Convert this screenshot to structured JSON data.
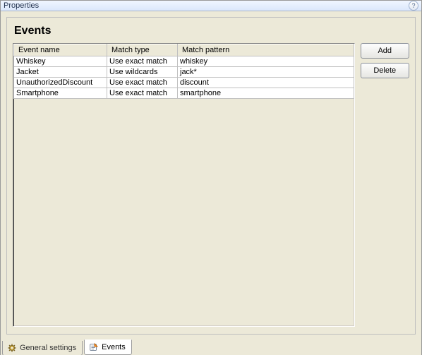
{
  "titlebar": {
    "title": "Properties"
  },
  "section": {
    "heading": "Events"
  },
  "table": {
    "columns": [
      "Event name",
      "Match type",
      "Match pattern"
    ],
    "rows": [
      {
        "name": "Whiskey",
        "match_type": "Use exact match",
        "pattern": "whiskey"
      },
      {
        "name": "Jacket",
        "match_type": "Use wildcards",
        "pattern": "jack*"
      },
      {
        "name": "UnauthorizedDiscount",
        "match_type": "Use exact match",
        "pattern": "discount"
      },
      {
        "name": "Smartphone",
        "match_type": "Use exact match",
        "pattern": "smartphone"
      }
    ]
  },
  "buttons": {
    "add": "Add",
    "delete": "Delete"
  },
  "tabs": {
    "general": "General settings",
    "events": "Events"
  }
}
